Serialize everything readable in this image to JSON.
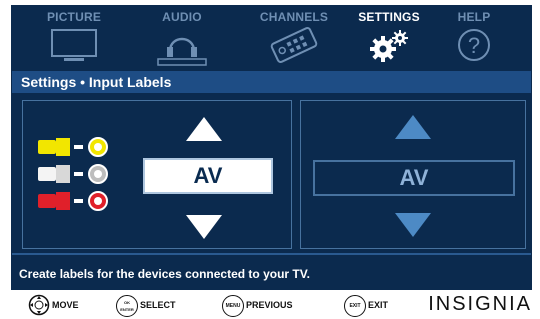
{
  "tabs": [
    {
      "label": "PICTURE",
      "icon": "tv-icon",
      "active": false
    },
    {
      "label": "AUDIO",
      "icon": "headphones-icon",
      "active": false
    },
    {
      "label": "CHANNELS",
      "icon": "remote-icon",
      "active": false
    },
    {
      "label": "SETTINGS",
      "icon": "gears-icon",
      "active": true
    },
    {
      "label": "HELP",
      "icon": "help-icon",
      "active": false
    }
  ],
  "header": {
    "title": "Settings • Input Labels"
  },
  "editor": {
    "current_label": "AV",
    "preview_label": "AV",
    "connectors": [
      {
        "color": "#f2e600",
        "icon": "yellow-rca-connector-icon"
      },
      {
        "color": "#f4f4f4",
        "icon": "white-rca-connector-icon"
      },
      {
        "color": "#e0202a",
        "icon": "red-rca-connector-icon"
      }
    ]
  },
  "description": "Create labels for the devices connected to your TV.",
  "footer": {
    "move": "MOVE",
    "ok_button": "OK\nENTER",
    "select": "SELECT",
    "menu_button": "MENU",
    "previous": "PREVIOUS",
    "exit_button": "EXIT",
    "exit": "EXIT",
    "brand": "INSIGNIA"
  },
  "colors": {
    "background": "#0b2a4e",
    "header": "#1e4d85",
    "accent": "#4d8ac5"
  }
}
